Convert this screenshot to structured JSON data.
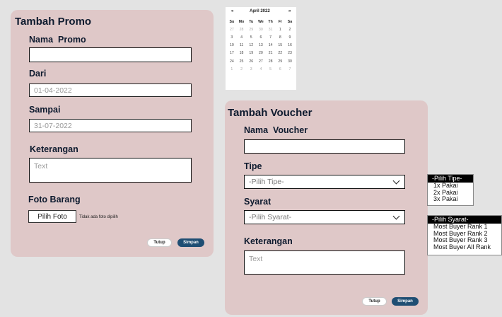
{
  "promo": {
    "title": "Tambah Promo",
    "nama_label": "Nama  Promo",
    "nama_value": "",
    "dari_label": "Dari",
    "dari_value": "01-04-2022",
    "sampai_label": "Sampai",
    "sampai_value": "31-07-2022",
    "keterangan_label": "Keterangan",
    "keterangan_placeholder": "Text",
    "foto_label": "Foto Barang",
    "foto_button": "Pilih Foto",
    "foto_status": "Tidak ada foto dipilih",
    "tutup_label": "Tutup",
    "simpan_label": "Simpan"
  },
  "calendar": {
    "prev": "«",
    "month": "April 2022",
    "next": "»",
    "weekdays": [
      "Su",
      "Mo",
      "Tu",
      "We",
      "Th",
      "Fr",
      "Sa"
    ],
    "weeks": [
      [
        "27",
        "28",
        "29",
        "30",
        "31",
        "1",
        "2"
      ],
      [
        "3",
        "4",
        "5",
        "6",
        "7",
        "8",
        "9"
      ],
      [
        "10",
        "11",
        "12",
        "13",
        "14",
        "15",
        "16"
      ],
      [
        "17",
        "18",
        "19",
        "20",
        "21",
        "22",
        "23"
      ],
      [
        "24",
        "25",
        "26",
        "27",
        "28",
        "29",
        "30"
      ],
      [
        "1",
        "2",
        "3",
        "4",
        "5",
        "6",
        "7"
      ]
    ]
  },
  "voucher": {
    "title": "Tambah Voucher",
    "nama_label": "Nama  Voucher",
    "nama_value": "",
    "tipe_label": "Tipe",
    "tipe_selected": "-Pilih Tipe-",
    "syarat_label": "Syarat",
    "syarat_selected": "-Pilih Syarat-",
    "keterangan_label": "Keterangan",
    "keterangan_placeholder": "Text",
    "tutup_label": "Tutup",
    "simpan_label": "Simpan"
  },
  "tipe_options": [
    "-Pilih Tipe-",
    "1x Pakai",
    "2x Pakai",
    "3x Pakai"
  ],
  "syarat_options": [
    "-Pilih Syarat-",
    "Most Buyer Rank 1",
    "Most Buyer Rank 2",
    "Most Buyer Rank 3",
    "Most Buyer All Rank"
  ],
  "colors": {
    "card": "#dfc8c8",
    "primary_button": "#1f4e73",
    "background": "#e3e3e3"
  }
}
